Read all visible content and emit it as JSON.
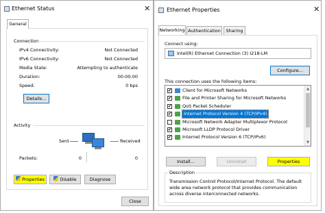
{
  "status_window": {
    "title": "Ethernet Status",
    "tab": "General",
    "connection": {
      "heading": "Connection",
      "rows": [
        {
          "label": "IPv4 Connectivity:",
          "value": "Not Connected"
        },
        {
          "label": "IPv6 Connectivity:",
          "value": "Not Connected"
        },
        {
          "label": "Media State:",
          "value": "Attempting to authenticate"
        },
        {
          "label": "Duration:",
          "value": "00:00:00"
        },
        {
          "label": "Speed:",
          "value": "0 bps"
        }
      ],
      "details_button": "Details..."
    },
    "activity": {
      "heading": "Activity",
      "sent": "Sent",
      "received": "Received",
      "packets_label": "Packets:",
      "packets_sent": "0",
      "packets_received": "0"
    },
    "buttons": {
      "properties": "Properties",
      "disable": "Disable",
      "diagnose": "Diagnose",
      "close": "Close"
    }
  },
  "properties_window": {
    "title": "Ethernet Properties",
    "tabs": [
      "Networking",
      "Authentication",
      "Sharing"
    ],
    "connect_using_label": "Connect using:",
    "adapter_name": "Intel(R) Ethernet Connection (3) I218-LM",
    "configure_button": "Configure...",
    "items_label": "This connection uses the following items:",
    "items": [
      {
        "label": "Client for Microsoft Networks",
        "checked": true,
        "icon": "network-client-icon"
      },
      {
        "label": "File and Printer Sharing for Microsoft Networks",
        "checked": true,
        "icon": "network-service-icon"
      },
      {
        "label": "QoS Packet Scheduler",
        "checked": true,
        "icon": "network-service-icon"
      },
      {
        "label": "Internet Protocol Version 4 (TCP/IPv4)",
        "checked": true,
        "selected": true,
        "icon": "protocol-icon"
      },
      {
        "label": "Microsoft Network Adapter Multiplexor Protocol",
        "checked": false,
        "icon": "protocol-icon"
      },
      {
        "label": "Microsoft LLDP Protocol Driver",
        "checked": true,
        "icon": "protocol-icon"
      },
      {
        "label": "Internet Protocol Version 6 (TCP/IPv6)",
        "checked": true,
        "icon": "protocol-icon"
      }
    ],
    "buttons": {
      "install": "Install...",
      "uninstall": "Uninstall",
      "properties": "Properties"
    },
    "description": {
      "heading": "Description",
      "lines": [
        "Transmission Control Protocol/Internet Protocol. The default",
        "wide area network protocol that provides communication",
        "across diverse interconnected networks."
      ]
    }
  },
  "colors": {
    "highlight": "#ffff00",
    "selection": "#0078d7"
  }
}
